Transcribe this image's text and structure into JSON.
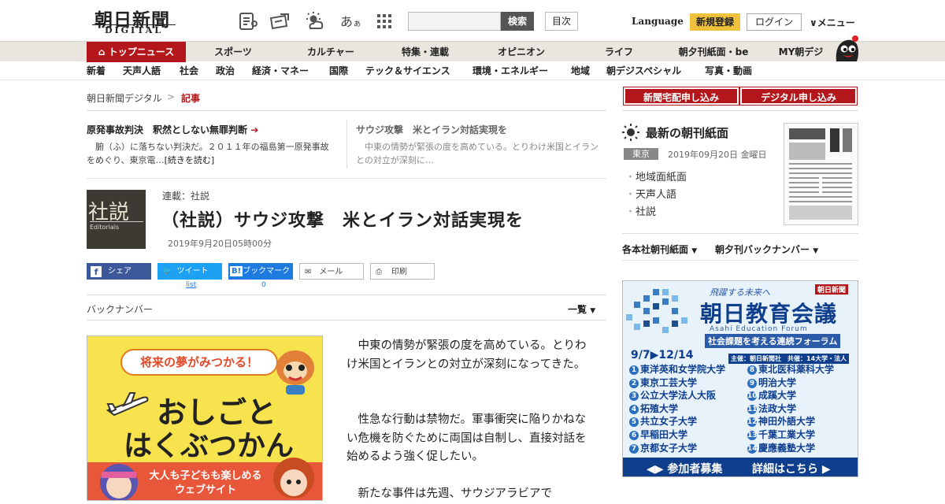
{
  "header": {
    "logo": "朝日新聞",
    "logo_sub": "DIGITAL",
    "icons": [
      "newspaper-icon",
      "ticket-icon",
      "weather-icon",
      "font-size-icon",
      "grid-menu-icon"
    ],
    "font_icon_text": "あ",
    "font_icon_text_small": "ぁ",
    "search_button": "検索",
    "mokuji": "目次",
    "language": "Language",
    "register": "新規登録",
    "login": "ログイン",
    "menu": "メニュー"
  },
  "nav1": [
    "トップニュース",
    "スポーツ",
    "カルチャー",
    "特集・連載",
    "オピニオン",
    "ライフ",
    "朝夕刊紙面・be",
    "MY朝デジ"
  ],
  "nav2": [
    "新着",
    "天声人語",
    "社会",
    "政治",
    "経済・マネー",
    "国際",
    "テック＆サイエンス",
    "環境・エネルギー",
    "地域",
    "朝デジスペシャル",
    "写真・動画"
  ],
  "breadcrumb": {
    "home": "朝日新聞デジタル",
    "sep": ">",
    "current": "記事"
  },
  "pickups": [
    {
      "title": "原発事故判決　釈然としない無罪判断",
      "text": "　腑（ふ）に落ちない判決だ。２０１１年の福島第一原発事故をめぐり、東京電…",
      "more": "[続きを読む]"
    },
    {
      "title": "サウジ攻撃　米とイラン対話実現を",
      "text": "　中東の情勢が緊張の度を高めている。とりわけ米国とイランとの対立が深刻に…"
    }
  ],
  "article": {
    "thumb_title": "社説",
    "thumb_sub": "Editorials",
    "series": "連載：社説",
    "title": "（社説）サウジ攻撃　米とイラン対話実現を",
    "date": "2019年9月20日05時00分",
    "paragraphs": [
      "　中東の情勢が緊張の度を高めている。とりわけ米国とイランとの対立が深刻になってきた。",
      "　性急な行動は禁物だ。軍事衝突に陥りかねない危機を防ぐために両国は自制し、直接対話を始めるよう強く促したい。",
      "　新たな事件は先週、サウジアラビアで"
    ]
  },
  "share": {
    "share": "シェア",
    "tweet": "ツイート",
    "bookmark": "ブックマーク",
    "bookmark_b": "B!",
    "mail": "メール",
    "print": "印刷",
    "tweet_count": "list",
    "bookmark_count": "0"
  },
  "backnumber": "バックナンバー",
  "ichiran": "一覧",
  "ad_left": {
    "banner": "将来の夢がみつかる！",
    "line1": "おしごと",
    "line2": "はくぶつかん",
    "line3": "大人も子どもも楽しめる",
    "line4": "ウェブサイト"
  },
  "sidebar": {
    "btn1": "新聞宅配申し込み",
    "btn2": "デジタル申し込み",
    "choukan_title": "最新の朝刊紙面",
    "region": "東京",
    "choukan_date": "2019年09月20日 金曜日",
    "links": [
      "地域面紙面",
      "天声人語",
      "社説"
    ],
    "dropdown1": "各本社朝刊紙面",
    "dropdown2": "朝夕刊バックナンバー"
  },
  "ad_right": {
    "tagline": "飛躍する未来へ",
    "brand": "朝日新聞",
    "title": "朝日教育会議",
    "title_en": "Asahi Education Forum",
    "subtitle": "社会課題を考える連続フォーラム",
    "dates": "9/7▶12/14",
    "host": "主催：朝日新聞社　共催：14大学・法人",
    "universities": [
      "東洋英和女学院大学",
      "東京工芸大学",
      "公立大学法人大阪",
      "拓殖大学",
      "共立女子大学",
      "早稲田大学",
      "京都女子大学",
      "東北医科薬科大学",
      "明治大学",
      "成蹊大学",
      "法政大学",
      "神田外語大学",
      "千葉工業大学",
      "慶應義塾大学"
    ],
    "cta1": "参加者募集",
    "cta2": "詳細はこちら"
  },
  "colors": {
    "accent": "#b3171b",
    "register": "#f0c13a",
    "facebook": "#3b5998",
    "twitter": "#1da1f2",
    "hatena": "#1d7be0"
  }
}
